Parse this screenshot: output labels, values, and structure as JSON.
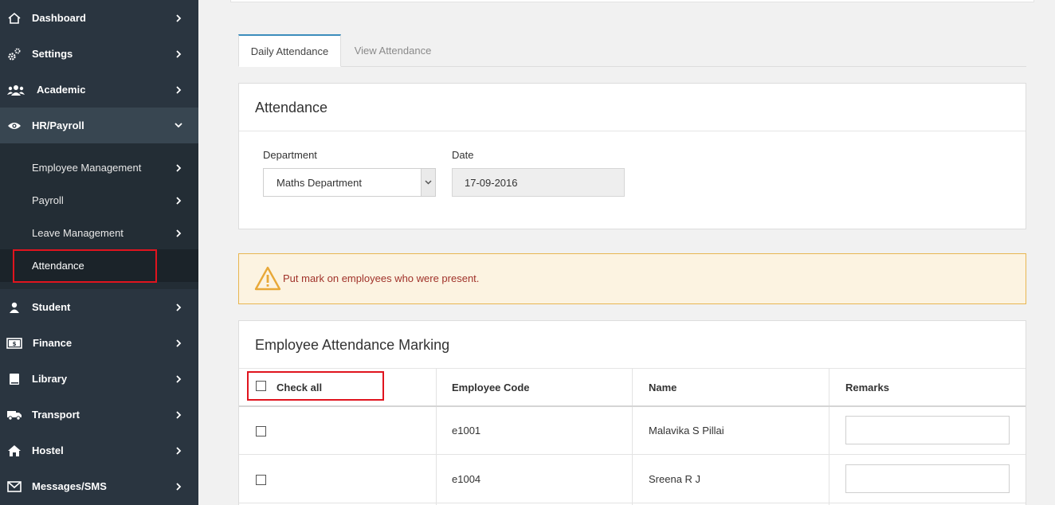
{
  "sidebar": {
    "items": [
      {
        "label": "Dashboard",
        "icon": "home-icon"
      },
      {
        "label": "Settings",
        "icon": "gears-icon"
      },
      {
        "label": "Academic",
        "icon": "users-icon"
      },
      {
        "label": "HR/Payroll",
        "icon": "eye-icon"
      },
      {
        "label": "Student",
        "icon": "user-icon"
      },
      {
        "label": "Finance",
        "icon": "money-icon"
      },
      {
        "label": "Library",
        "icon": "book-icon"
      },
      {
        "label": "Transport",
        "icon": "truck-icon"
      },
      {
        "label": "Hostel",
        "icon": "house-icon"
      },
      {
        "label": "Messages/SMS",
        "icon": "envelope-icon"
      }
    ],
    "hr_subitems": [
      {
        "label": "Employee Management"
      },
      {
        "label": "Payroll"
      },
      {
        "label": "Leave Management"
      },
      {
        "label": "Attendance"
      }
    ]
  },
  "tabs": [
    {
      "label": "Daily Attendance",
      "active": true
    },
    {
      "label": "View Attendance",
      "active": false
    }
  ],
  "attendance_panel": {
    "title": "Attendance",
    "department_label": "Department",
    "department_value": "Maths Department",
    "date_label": "Date",
    "date_value": "17-09-2016"
  },
  "alert": {
    "message": "Put mark on employees who were present.",
    "icon": "warning-icon"
  },
  "marking_panel": {
    "title": "Employee Attendance Marking",
    "columns": [
      "Check all",
      "Employee Code",
      "Name",
      "Remarks"
    ],
    "rows": [
      {
        "code": "e1001",
        "name": "Malavika S Pillai",
        "remarks": ""
      },
      {
        "code": "e1004",
        "name": "Sreena R J",
        "remarks": ""
      }
    ]
  },
  "colors": {
    "sidebar_bg": "#2a3540",
    "tab_accent": "#3c8dbc",
    "highlight_red": "#e0141e",
    "alert_bg": "#fcf3e1",
    "alert_text": "#a0322a"
  }
}
